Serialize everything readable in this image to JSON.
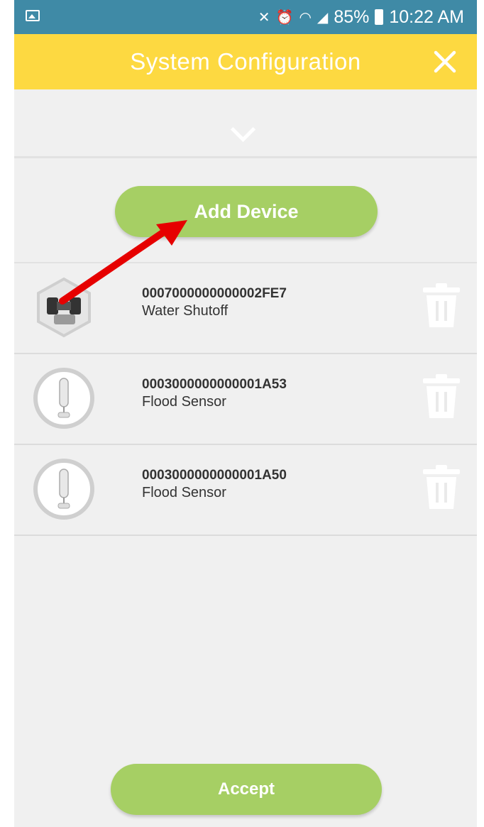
{
  "status_bar": {
    "battery_percent": "85%",
    "time": "10:22 AM"
  },
  "header": {
    "title": "System Configuration"
  },
  "actions": {
    "add_device_label": "Add Device",
    "accept_label": "Accept"
  },
  "devices": [
    {
      "id": "0007000000000002FE7",
      "type": "Water Shutoff",
      "icon": "water-shutoff-icon"
    },
    {
      "id": "0003000000000001A53",
      "type": "Flood Sensor",
      "icon": "flood-sensor-icon"
    },
    {
      "id": "0003000000000001A50",
      "type": "Flood Sensor",
      "icon": "flood-sensor-icon"
    }
  ],
  "colors": {
    "status_bar": "#3f8aa6",
    "app_bar": "#fdd941",
    "button": "#a6cf64",
    "background": "#f0f0f0",
    "annotation_arrow": "#e60000"
  }
}
